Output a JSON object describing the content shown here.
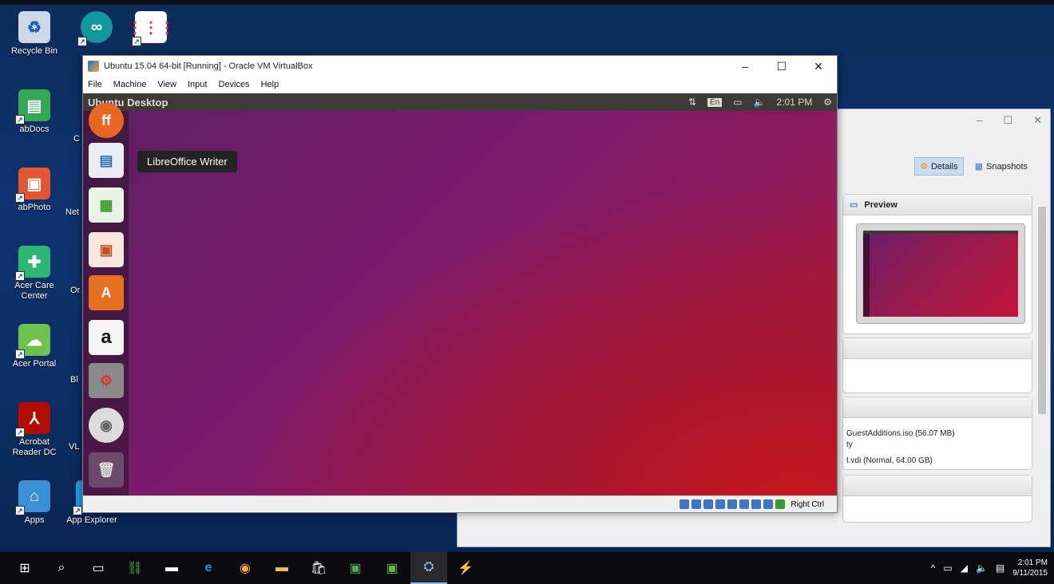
{
  "desktop": {
    "icons": [
      {
        "label": "Recycle Bin",
        "icon": "recycle-bin-icon"
      },
      {
        "label": "abDocs",
        "icon": "abdocs-icon"
      },
      {
        "label": "abPhoto",
        "icon": "abphoto-icon"
      },
      {
        "label": "Acer Care Center",
        "icon": "acer-care-icon"
      },
      {
        "label": "Acer Portal",
        "icon": "acer-portal-icon"
      },
      {
        "label": "Acrobat Reader DC",
        "icon": "acrobat-icon"
      },
      {
        "label": "Apps",
        "icon": "apps-icon"
      },
      {
        "label": "App Explorer",
        "icon": "app-explorer-icon"
      }
    ],
    "partial_labels": [
      "Arduino",
      "Chrome App",
      "C",
      "Net",
      "Or Vi",
      "Bl",
      "VL"
    ]
  },
  "vm_window": {
    "title": "Ubuntu 15.04 64-bit [Running] - Oracle VM VirtualBox",
    "menu": [
      "File",
      "Machine",
      "View",
      "Input",
      "Devices",
      "Help"
    ],
    "status_host_key": "Right Ctrl"
  },
  "guest": {
    "top_bar_title": "Ubuntu Desktop",
    "lang": "En",
    "time": "2:01 PM",
    "tooltip": "LibreOffice Writer",
    "launcher": [
      {
        "name": "firefox-icon",
        "color": "#e8661f"
      },
      {
        "name": "libreoffice-writer-icon",
        "color": "#2f6fb6"
      },
      {
        "name": "libreoffice-calc-icon",
        "color": "#3f9a2f"
      },
      {
        "name": "libreoffice-impress-icon",
        "color": "#c4521f"
      },
      {
        "name": "software-center-icon",
        "color": "#e7701e"
      },
      {
        "name": "amazon-icon",
        "color": "#f5f5f5"
      },
      {
        "name": "system-settings-icon",
        "color": "#9a9a9a"
      },
      {
        "name": "dvd-icon",
        "color": "#dcdcdc"
      },
      {
        "name": "trash-icon",
        "color": "#7a5a7a"
      }
    ]
  },
  "manager": {
    "details_label": "Details",
    "snapshots_label": "Snapshots",
    "preview_label": "Preview",
    "lines": [
      "GuestAdditions.iso (56.07 MB)",
      "ty",
      "t.vdi (Normal, 64.00 GB)"
    ]
  },
  "taskbar": {
    "time": "2:01 PM",
    "date": "9/11/2015"
  }
}
